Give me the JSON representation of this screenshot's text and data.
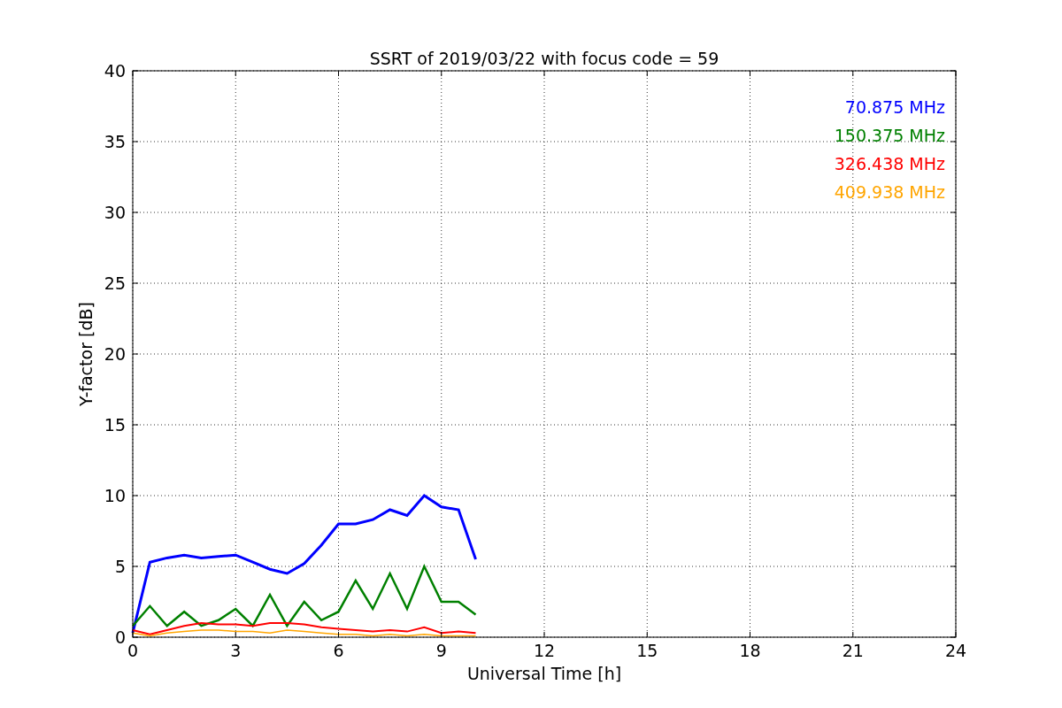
{
  "chart_data": {
    "type": "line",
    "title": "SSRT of 2019/03/22 with focus code = 59",
    "xlabel": "Universal Time [h]",
    "ylabel": "Y-factor [dB]",
    "x": [
      0,
      0.5,
      1,
      1.5,
      2,
      2.5,
      3,
      3.5,
      4,
      4.5,
      5,
      5.5,
      6,
      6.5,
      7,
      7.5,
      8,
      8.5,
      9,
      9.5,
      10
    ],
    "series": [
      {
        "name": "70.875 MHz",
        "color": "#0000ff",
        "values": [
          0.3,
          5.3,
          5.6,
          5.8,
          5.6,
          5.7,
          5.8,
          5.3,
          4.8,
          4.5,
          5.2,
          6.5,
          8,
          8,
          8.3,
          9,
          8.6,
          10,
          9.2,
          9,
          5.5
        ]
      },
      {
        "name": "150.375 MHz",
        "color": "#008000",
        "values": [
          0.8,
          2.2,
          0.8,
          1.8,
          0.8,
          1.2,
          2,
          0.8,
          3,
          0.8,
          2.5,
          1.2,
          1.8,
          4,
          2,
          4.5,
          2,
          5,
          2.5,
          2.5,
          1.6
        ]
      },
      {
        "name": "326.438 MHz",
        "color": "#ff0000",
        "values": [
          0.5,
          0.2,
          0.5,
          0.8,
          1,
          0.9,
          0.9,
          0.8,
          1,
          1,
          0.9,
          0.7,
          0.6,
          0.5,
          0.4,
          0.5,
          0.4,
          0.7,
          0.3,
          0.4,
          0.3
        ]
      },
      {
        "name": "409.938 MHz",
        "color": "#ffa500",
        "values": [
          0.3,
          0.1,
          0.3,
          0.4,
          0.5,
          0.5,
          0.4,
          0.4,
          0.3,
          0.5,
          0.4,
          0.3,
          0.2,
          0.2,
          0.1,
          0.2,
          0.1,
          0.2,
          0.1,
          0.1,
          0.1
        ]
      }
    ],
    "grid": true,
    "xlim": [
      0,
      24
    ],
    "ylim": [
      0,
      40
    ],
    "xticks": [
      0,
      3,
      6,
      9,
      12,
      15,
      18,
      21,
      24
    ],
    "yticks": [
      0,
      5,
      10,
      15,
      20,
      25,
      30,
      35,
      40
    ]
  }
}
